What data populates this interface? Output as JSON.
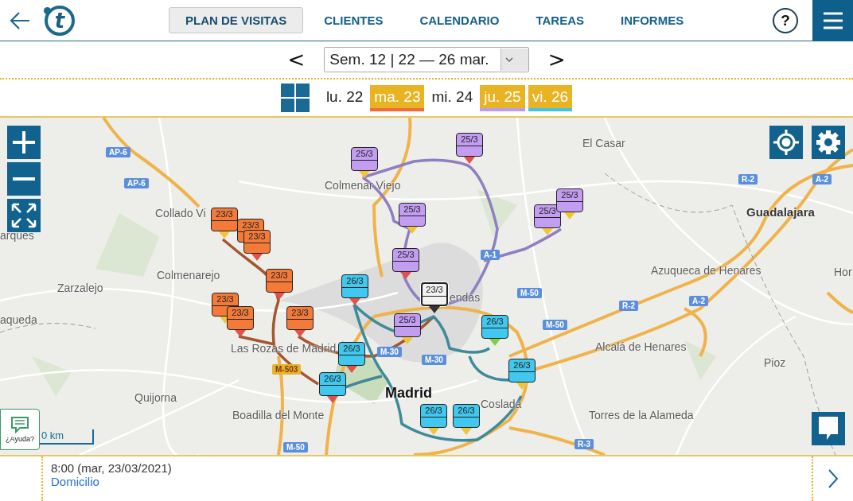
{
  "header": {
    "logo_letter": "t",
    "tabs": [
      {
        "label": "PLAN DE VISITAS",
        "selected": true
      },
      {
        "label": "CLIENTES",
        "selected": false
      },
      {
        "label": "CALENDARIO",
        "selected": false
      },
      {
        "label": "TAREAS",
        "selected": false
      },
      {
        "label": "INFORMES",
        "selected": false
      }
    ],
    "help": "?"
  },
  "week": {
    "prev": "<",
    "next": ">",
    "value": "Sem. 12 | 22 — 26 mar."
  },
  "days": [
    {
      "label": "lu. 22",
      "has_visits": false
    },
    {
      "label": "ma. 23",
      "has_visits": true,
      "color": "#f26b3a"
    },
    {
      "label": "mi. 24",
      "has_visits": false
    },
    {
      "label": "ju. 25",
      "has_visits": true,
      "color": "#b99cf0"
    },
    {
      "label": "vi. 26",
      "has_visits": true,
      "color": "#3cc4ea"
    }
  ],
  "map": {
    "places": [
      {
        "name": "El Casar",
        "kind": "town"
      },
      {
        "name": "Colmenar Viejo",
        "kind": "town"
      },
      {
        "name": "Collado Vi",
        "kind": "town"
      },
      {
        "name": "Guadalajara",
        "kind": "city"
      },
      {
        "name": "arques",
        "kind": "town"
      },
      {
        "name": "Colmenarejo",
        "kind": "town"
      },
      {
        "name": "Zarzalejo",
        "kind": "town"
      },
      {
        "name": "Azuqueca de Henares",
        "kind": "town"
      },
      {
        "name": "Hor",
        "kind": "town"
      },
      {
        "name": "aqueda",
        "kind": "town"
      },
      {
        "name": "Las Rozas de Madrid",
        "kind": "town"
      },
      {
        "name": "endas",
        "kind": "town"
      },
      {
        "name": "Alcalá de Henares",
        "kind": "town"
      },
      {
        "name": "Pioz",
        "kind": "town"
      },
      {
        "name": "Quijorna",
        "kind": "town"
      },
      {
        "name": "Madrid",
        "kind": "capital"
      },
      {
        "name": "Coslada",
        "kind": "town"
      },
      {
        "name": "Boadilla del Monte",
        "kind": "town"
      },
      {
        "name": "Torres de la Alameda",
        "kind": "town"
      }
    ],
    "roads": [
      {
        "label": "AP-6",
        "kind": "national"
      },
      {
        "label": "AP-6",
        "kind": "national"
      },
      {
        "label": "R-2",
        "kind": "national"
      },
      {
        "label": "A-2",
        "kind": "national"
      },
      {
        "label": "A-1",
        "kind": "national"
      },
      {
        "label": "M-50",
        "kind": "national"
      },
      {
        "label": "R-2",
        "kind": "national"
      },
      {
        "label": "A-2",
        "kind": "national"
      },
      {
        "label": "M-50",
        "kind": "national"
      },
      {
        "label": "M-30",
        "kind": "national"
      },
      {
        "label": "M-30",
        "kind": "national"
      },
      {
        "label": "M-503",
        "kind": "regional"
      },
      {
        "label": "M-50",
        "kind": "national"
      },
      {
        "label": "R-3",
        "kind": "national"
      }
    ],
    "markers": [
      {
        "label": "25/3",
        "color": "#c39df2",
        "tip": {
          "color": "#f0c53a"
        },
        "selected": false
      },
      {
        "label": "25/3",
        "color": "#c39df2",
        "tip": {
          "color": "#e0524a"
        },
        "selected": false
      },
      {
        "label": "25/3",
        "color": "#c39df2",
        "tip": {
          "color": "#f0c53a"
        },
        "selected": false
      },
      {
        "label": "25/3",
        "color": "#c39df2",
        "tip": {
          "color": "#e0524a"
        },
        "selected": false
      },
      {
        "label": "25/3",
        "color": "#c39df2",
        "tip": {
          "color": "#f0c53a"
        },
        "selected": false
      },
      {
        "label": "25/3",
        "color": "#c39df2",
        "tip": {
          "color": "#f0c53a"
        },
        "selected": false
      },
      {
        "label": "25/3",
        "color": "#c39df2",
        "tip": {
          "color": "#f0c53a"
        },
        "selected": false
      },
      {
        "label": "23/3",
        "color": "#f2f2f2",
        "tip": {
          "color": "#333333"
        },
        "selected": true
      },
      {
        "label": "23/3",
        "color": "#f47a3a",
        "tip": {
          "color": "#f0c53a"
        },
        "selected": false
      },
      {
        "label": "23/3",
        "color": "#f47a3a",
        "selected": false
      },
      {
        "label": "23/3",
        "color": "#f47a3a",
        "tip": {
          "color": "#e0524a"
        },
        "selected": false
      },
      {
        "label": "23/3",
        "color": "#f47a3a",
        "tip": {
          "color": "#e0524a"
        },
        "selected": false
      },
      {
        "label": "23/3",
        "color": "#f47a3a",
        "tip": {
          "color": "#f0c53a"
        },
        "selected": false
      },
      {
        "label": "23/3",
        "color": "#f47a3a",
        "tip": {
          "color": "#e0524a"
        },
        "selected": false
      },
      {
        "label": "23/3",
        "color": "#f47a3a",
        "tip": {
          "color": "#e0524a"
        },
        "selected": false
      },
      {
        "label": "26/3",
        "color": "#40c8ee",
        "tip": {
          "color": "#e0524a"
        },
        "selected": false
      },
      {
        "label": "26/3",
        "color": "#40c8ee",
        "tip": {
          "color": "#7ed04a"
        },
        "selected": false
      },
      {
        "label": "26/3",
        "color": "#40c8ee",
        "tip": {
          "color": "#e0524a"
        },
        "selected": false
      },
      {
        "label": "26/3",
        "color": "#40c8ee",
        "tip": {
          "color": "#e0524a"
        },
        "selected": false
      },
      {
        "label": "26/3",
        "color": "#40c8ee",
        "tip": {
          "color": "#f0c53a"
        },
        "selected": false
      },
      {
        "label": "26/3",
        "color": "#40c8ee",
        "tip": {
          "color": "#f0c53a"
        },
        "selected": false
      },
      {
        "label": "26/3",
        "color": "#40c8ee",
        "tip": {
          "color": "#f0c53a"
        },
        "selected": false
      }
    ],
    "scale": "0 km",
    "help_label": "¿Ayuda?"
  },
  "visit": {
    "time": "8:00 (mar, 23/03/2021)",
    "place": "Domicilio"
  }
}
